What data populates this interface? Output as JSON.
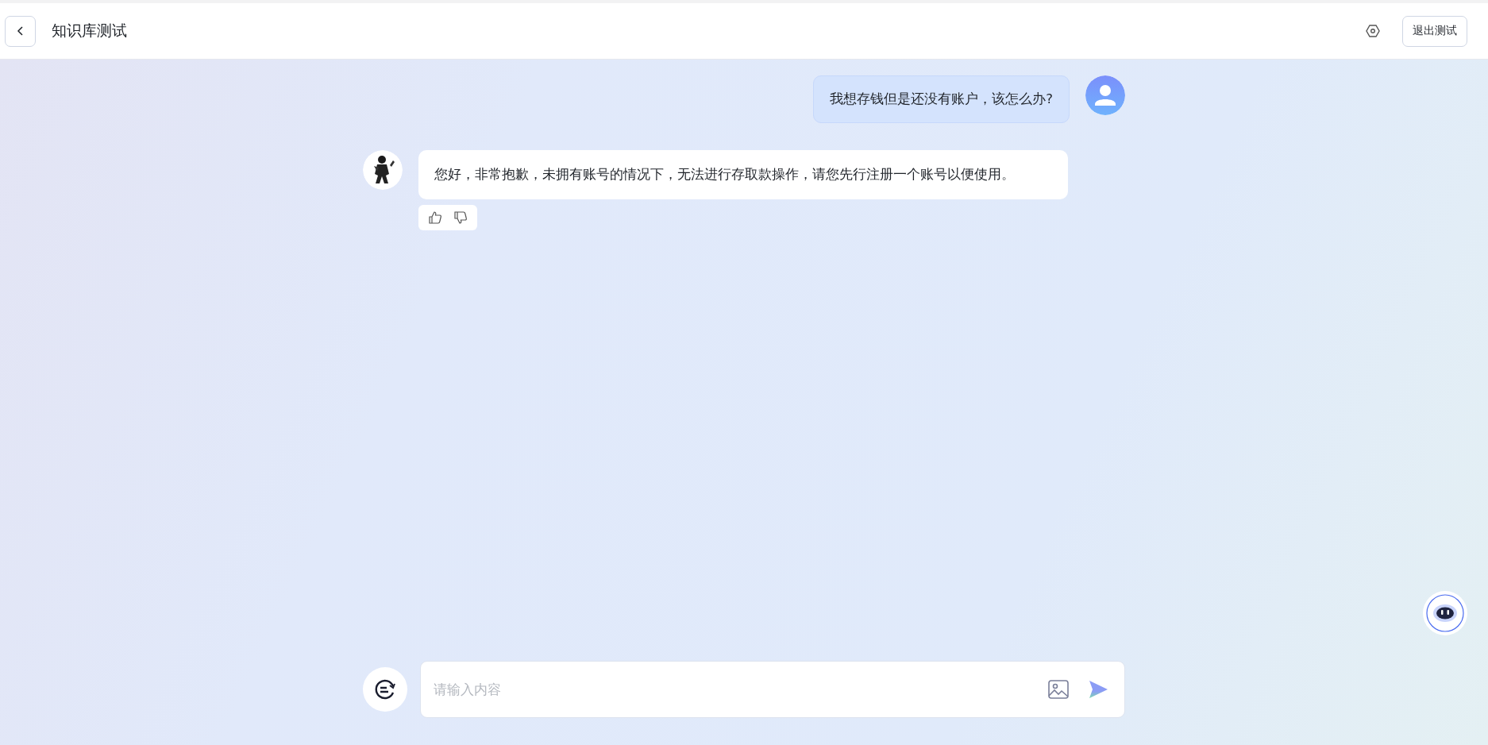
{
  "header": {
    "title": "知识库测试",
    "exit_button": "退出测试"
  },
  "messages": [
    {
      "kind": "user",
      "text": "我想存钱但是还没有账户，该怎么办?"
    },
    {
      "kind": "assistant",
      "text": "您好，非常抱歉，未拥有账号的情况下，无法进行存取款操作，请您先行注册一个账号以便使用。"
    }
  ],
  "input": {
    "placeholder": "请输入内容"
  }
}
